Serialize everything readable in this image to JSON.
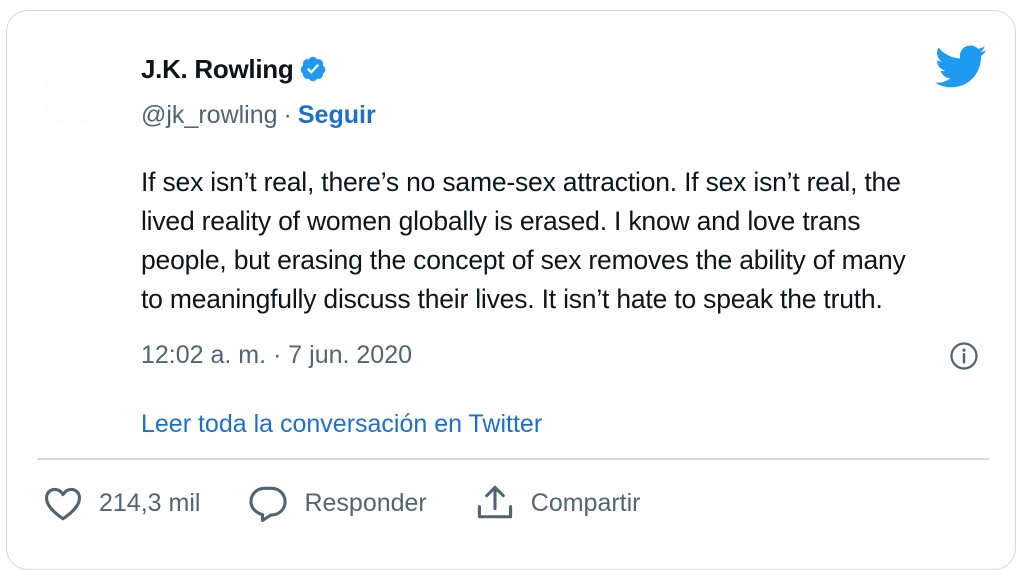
{
  "author": {
    "display_name": "J.K. Rowling",
    "handle": "@jk_rowling",
    "separator": "·",
    "follow_label": "Seguir"
  },
  "tweet": {
    "text": "If sex isn’t real, there’s no same-sex attraction. If sex isn’t real, the\nlived reality of women globally is erased. I know and love trans\npeople, but erasing the concept of sex removes the ability of many\nto meaningfully discuss their lives. It isn’t hate to speak the truth.",
    "timestamp": "12:02 a. m. · 7 jun. 2020"
  },
  "read_more_label": "Leer toda la conversación en Twitter",
  "actions": {
    "likes": "214,3 mil",
    "reply_label": "Responder",
    "share_label": "Compartir"
  },
  "icons": {
    "verified": "verified-badge-icon",
    "brand": "twitter-bird-icon",
    "info": "info-icon",
    "like": "heart-icon",
    "reply": "reply-bubble-icon",
    "share": "share-icon"
  },
  "colors": {
    "brand_blue": "#1d9bf0",
    "link_blue": "#1d6fcc",
    "text": "#0f1419",
    "muted": "#536471",
    "border": "#cfd9de"
  }
}
